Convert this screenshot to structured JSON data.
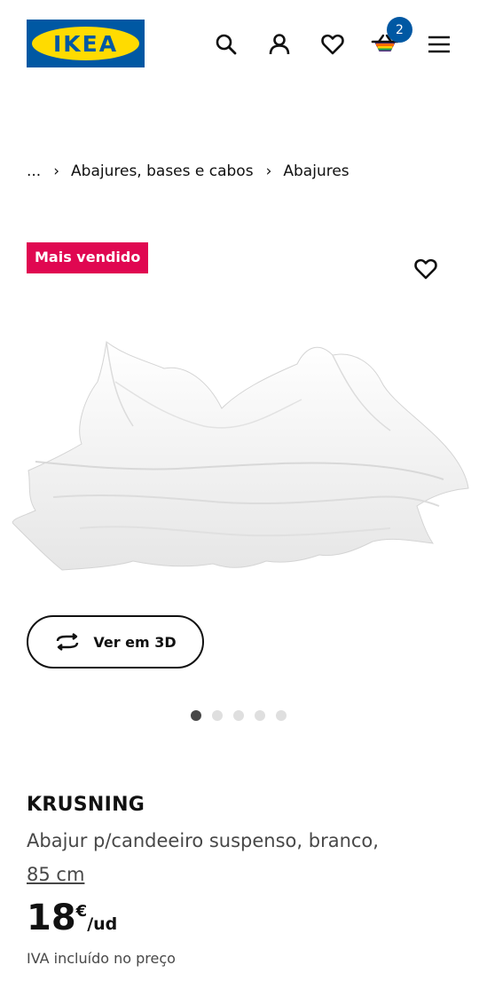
{
  "header": {
    "logo_text": "IKEA",
    "cart_count": "2",
    "icons": [
      "search-icon",
      "account-icon",
      "heart-icon",
      "cart-icon",
      "menu-icon"
    ]
  },
  "breadcrumb": {
    "ellipsis": "...",
    "items": [
      "Abajures, bases e cabos",
      "Abajures"
    ]
  },
  "product": {
    "tag": "Mais vendido",
    "view3d_label": "Ver em 3D",
    "carousel_count": 5,
    "carousel_active": 1,
    "name": "KRUSNING",
    "description": "Abajur p/candeeiro suspenso, branco,",
    "size": "85 cm",
    "price_int": "18",
    "price_currency": "€",
    "price_unit": "/ud",
    "vat_note": "IVA incluído no preço"
  },
  "colors": {
    "brand_blue": "#0058a3",
    "brand_yellow": "#ffdb00",
    "tag_red": "#e00751"
  }
}
